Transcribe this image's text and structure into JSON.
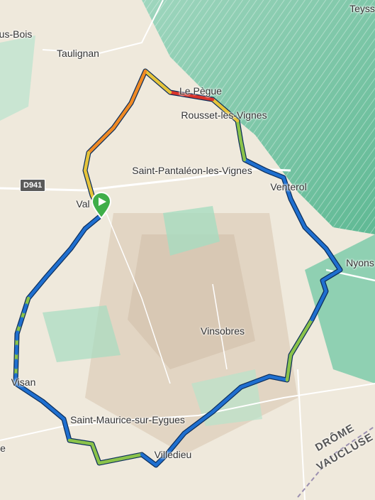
{
  "map": {
    "places": [
      {
        "id": "teyss",
        "label": "Teyss"
      },
      {
        "id": "bois",
        "label": "us-Bois"
      },
      {
        "id": "taulignan",
        "label": "Taulignan"
      },
      {
        "id": "le-pegue",
        "label": "Le Pègue"
      },
      {
        "id": "rousset",
        "label": "Rousset-les-Vignes"
      },
      {
        "id": "saint-pantaleon",
        "label": "Saint-Pantaléon-les-Vignes"
      },
      {
        "id": "valreas",
        "label": "Val"
      },
      {
        "id": "venterol",
        "label": "Venterol"
      },
      {
        "id": "nyons",
        "label": "Nyons"
      },
      {
        "id": "vinsobres",
        "label": "Vinsobres"
      },
      {
        "id": "visan",
        "label": "Visan"
      },
      {
        "id": "saint-maurice",
        "label": "Saint-Maurice-sur-Eygues"
      },
      {
        "id": "villedieu",
        "label": "Villedieu"
      },
      {
        "id": "edge-e",
        "label": "e"
      }
    ],
    "road_shield": "D941",
    "regions": [
      "DRÔME",
      "VAUCLUSE"
    ],
    "start_marker": "start-play-icon",
    "colors": {
      "route_blue": "#1f6fd0",
      "route_green": "#8bc34a",
      "route_yellow": "#e6c43a",
      "route_orange": "#f08a24",
      "route_red": "#d9342b",
      "pin_green": "#3fae49",
      "terrain": "#efe9dc",
      "mountain": "#7fc9a8"
    }
  }
}
